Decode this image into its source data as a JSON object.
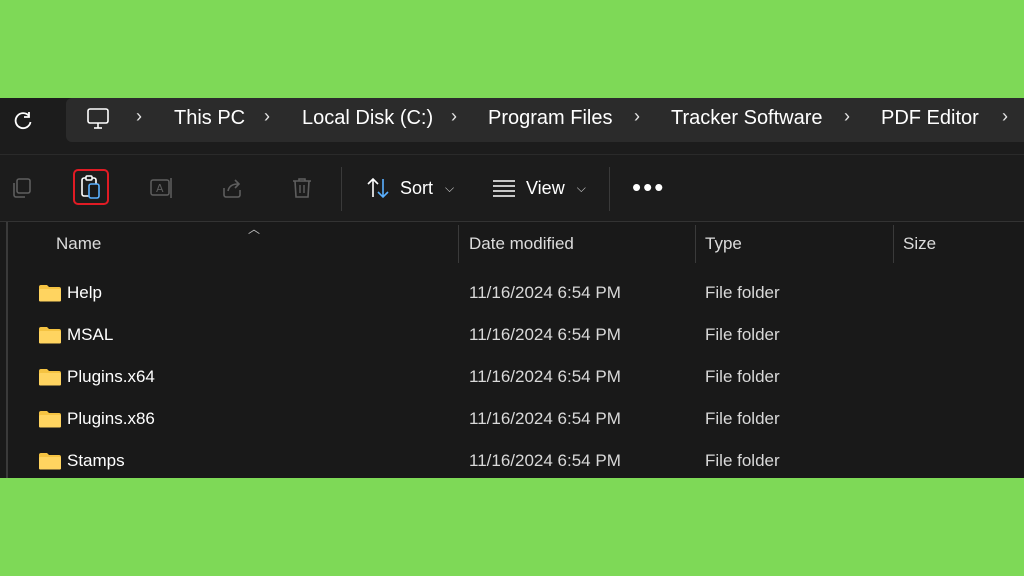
{
  "breadcrumb": {
    "items": [
      "This PC",
      "Local Disk (C:)",
      "Program Files",
      "Tracker Software",
      "PDF Editor"
    ]
  },
  "toolbar": {
    "sort_label": "Sort",
    "view_label": "View"
  },
  "columns": {
    "name": "Name",
    "date_modified": "Date modified",
    "type": "Type",
    "size": "Size"
  },
  "files": [
    {
      "name": "Help",
      "date": "11/16/2024 6:54 PM",
      "type": "File folder"
    },
    {
      "name": "MSAL",
      "date": "11/16/2024 6:54 PM",
      "type": "File folder"
    },
    {
      "name": "Plugins.x64",
      "date": "11/16/2024 6:54 PM",
      "type": "File folder"
    },
    {
      "name": "Plugins.x86",
      "date": "11/16/2024 6:54 PM",
      "type": "File folder"
    },
    {
      "name": "Stamps",
      "date": "11/16/2024 6:54 PM",
      "type": "File folder"
    }
  ],
  "colors": {
    "background": "#7ed957",
    "window": "#191919",
    "highlight": "#e01b24",
    "folder": "#f5c342"
  }
}
